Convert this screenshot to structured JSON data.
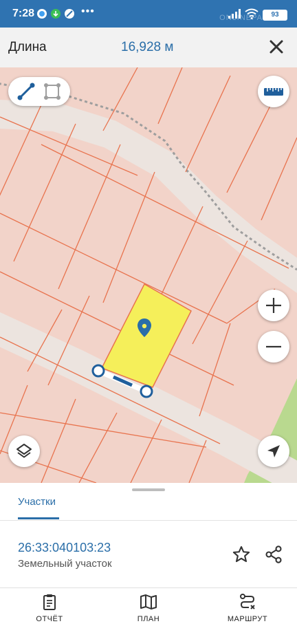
{
  "status_bar": {
    "time": "7:28",
    "battery": "93",
    "watermark": "ONLINEPALT"
  },
  "toolbar": {
    "title": "Длина",
    "value": "16,928 м",
    "close_icon": "close-icon"
  },
  "map": {
    "tools": [
      "line-measure-icon",
      "area-measure-icon"
    ],
    "ruler_icon": "ruler-icon",
    "zoom_in": "+",
    "zoom_out": "−",
    "layers_icon": "layers-icon",
    "locate_icon": "navigation-arrow-icon",
    "colors": {
      "background": "#f2d3c9",
      "parcel_border": "#e8734e",
      "selected_parcel": "#f5ef5a",
      "road": "#ece4df",
      "green_area": "#b9d98f",
      "accent": "#2a6ea8"
    }
  },
  "bottom_sheet": {
    "tab": "Участки",
    "parcel": {
      "cadastral_number": "26:33:040103:23",
      "type": "Земельный участок"
    }
  },
  "bottom_nav": [
    {
      "label": "ОТЧЁТ",
      "icon": "report-icon"
    },
    {
      "label": "ПЛАН",
      "icon": "map-plan-icon"
    },
    {
      "label": "МАРШРУТ",
      "icon": "route-icon"
    }
  ]
}
